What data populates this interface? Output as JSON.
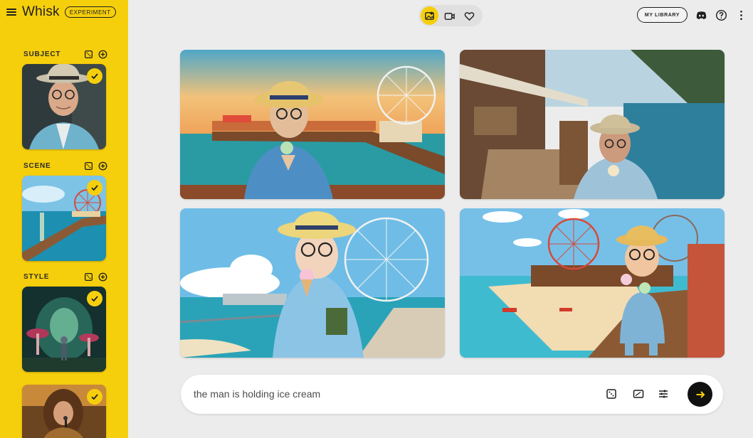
{
  "app": {
    "name": "Whisk",
    "badge": "EXPERIMENT"
  },
  "sidebar": {
    "sections": [
      {
        "title": "SUBJECT",
        "thumbnail": "elderly man in straw hat and blue blazer"
      },
      {
        "title": "SCENE",
        "thumbnail": "pier with ferris wheel by the sea"
      },
      {
        "title": "STYLE",
        "thumbnail": "glowing mushroom forest with robot"
      },
      {
        "title": "",
        "thumbnail": "rock singer with microphone"
      }
    ],
    "icons": {
      "menu": "menu-icon",
      "dice": "dice-icon",
      "add": "add-circle-icon",
      "check": "check-icon"
    }
  },
  "topbar": {
    "modes": [
      "image-mode-icon",
      "video-mode-icon",
      "favorites-heart-icon"
    ],
    "library_label": "MY LIBRARY",
    "icons": [
      "discord-icon",
      "help-icon",
      "more-vert-icon"
    ]
  },
  "results": [
    {
      "name": "result-image-1",
      "description": "illustrated man eating ice cream on pier at sunset"
    },
    {
      "name": "result-image-2",
      "description": "realistic man eating ice cream on seaside boardwalk"
    },
    {
      "name": "result-image-3",
      "description": "anime man holding ice cream and book by ferris wheel"
    },
    {
      "name": "result-image-4",
      "description": "3D cartoon man with ice cream on beach pier"
    }
  ],
  "prompt": {
    "value": "the man is holding ice cream",
    "icons": [
      "dice-icon",
      "aspect-ratio-icon",
      "settings-sliders-icon",
      "send-arrow-icon"
    ]
  },
  "colors": {
    "accent": "#f6cf0c",
    "background": "#ececec",
    "send_button": "#111111"
  }
}
